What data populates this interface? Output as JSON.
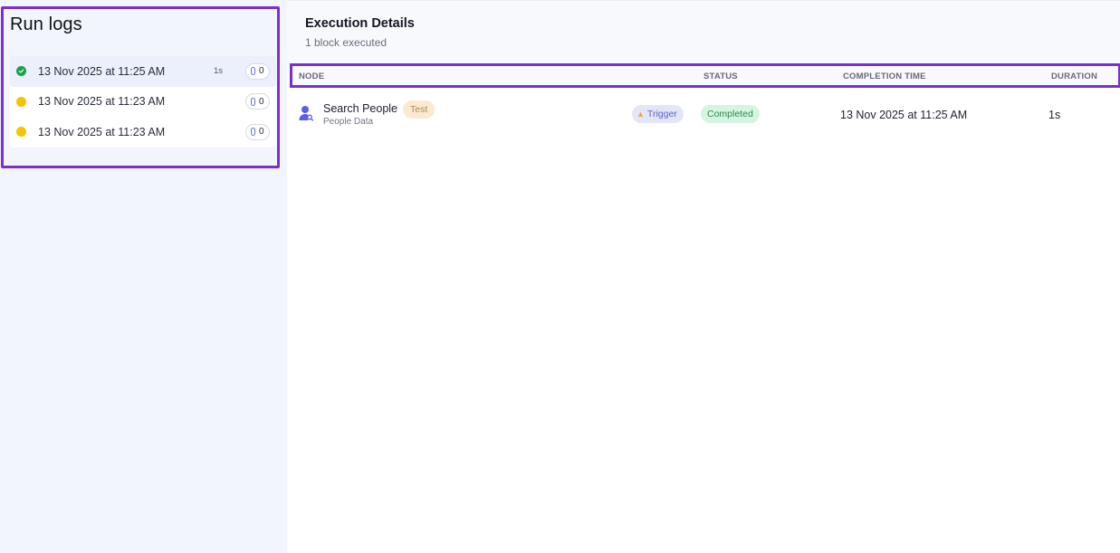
{
  "sidebar": {
    "title": "Run logs",
    "runs": [
      {
        "label": "13 Nov 2025 at 11:25 AM",
        "duration": "1s",
        "credits": "0",
        "status": "success"
      },
      {
        "label": "13 Nov 2025 at 11:23 AM",
        "duration": "",
        "credits": "0",
        "status": "pending"
      },
      {
        "label": "13 Nov 2025 at 11:23 AM",
        "duration": "",
        "credits": "0",
        "status": "pending"
      }
    ]
  },
  "main": {
    "title": "Execution Details",
    "subtitle": "1 block executed",
    "columns": {
      "node": "NODE",
      "status": "STATUS",
      "completion_time": "COMPLETION TIME",
      "duration": "DURATION"
    },
    "rows": [
      {
        "node_name": "Search People",
        "node_sub": "People Data",
        "test_tag": "Test",
        "trigger_tag": "Trigger",
        "status": "Completed",
        "completion_time": "13 Nov 2025 at 11:25 AM",
        "duration": "1s",
        "icon": "user-search-icon"
      }
    ]
  },
  "colors": {
    "highlight_border": "#7a2fd0",
    "success": "#16a34a",
    "pending": "#f5c400",
    "node_icon": "#5b5fe8"
  }
}
